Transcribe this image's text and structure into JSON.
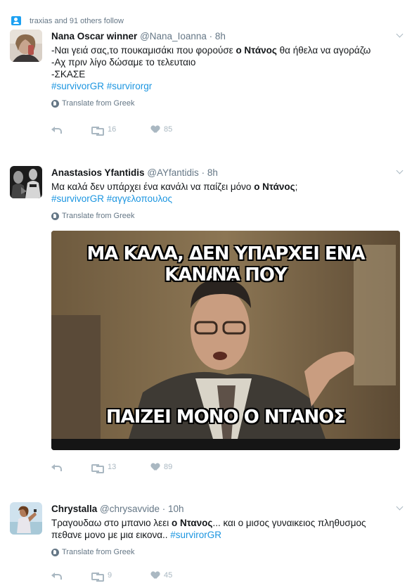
{
  "context": {
    "follow_text": "traxias and 91 others follow"
  },
  "tweets": [
    {
      "name": "Nana Oscar winner",
      "handle": "@Nana_Ioanna",
      "time": "· 8h",
      "lines": [
        {
          "pre": "-Ναι γειά σας,το πουκαμισάκι που φορούσε ",
          "bold": "ο Ντάνος",
          "post": " θα ήθελα να αγοράζω"
        },
        {
          "pre": "-Αχ πριν λίγο δώσαμε το τελευταιο",
          "bold": "",
          "post": ""
        },
        {
          "pre": "-ΣΚΑΣΕ",
          "bold": "",
          "post": ""
        }
      ],
      "hashtags": "#survivorGR #survirorgr",
      "translate": "Translate from Greek",
      "retweets": "16",
      "likes": "85"
    },
    {
      "name": "Anastasios Yfantidis",
      "handle": "@AYfantidis",
      "time": "· 8h",
      "lines": [
        {
          "pre": "Μα καλά δεν υπάρχει ένα κανάλι να παίζει μόνο ",
          "bold": "ο Ντάνος",
          "post": ";"
        }
      ],
      "hashtags": "#survivorGR #αγγελοπουλος",
      "translate": "Translate from Greek",
      "image": {
        "top_text_line1": "ΜΑ ΚΑΛΑ, ΔΕΝ ΥΠΑΡΧΕΙ ΕΝΑ ΚΑΝΑΛΙ ΠΟΥ",
        "top_text_line2": "ΝΑ",
        "bottom_text": "ΠΑΙΖΕΙ ΜΟΝΟ Ο ΝΤΑΝΟΣ"
      },
      "retweets": "13",
      "likes": "89"
    },
    {
      "name": "Chrystalla",
      "handle": "@chrysavvide",
      "time": "· 10h",
      "lines": [
        {
          "pre": "Τραγουδαω στο μπανιο λεει ",
          "bold": "ο Ντανος",
          "post": "... και ο μισος γυναικειος πληθυσμος"
        },
        {
          "pre": "πεθανε μονο με μια εικονα.. ",
          "bold": "",
          "post": "",
          "tag": "#survirorGR"
        }
      ],
      "translate": "Translate from Greek",
      "retweets": "9",
      "likes": "45"
    }
  ],
  "colors": {
    "link": "#1b95e0",
    "muted": "#657786",
    "action": "#aab8c2",
    "follow_icon": "#1da1f2"
  }
}
